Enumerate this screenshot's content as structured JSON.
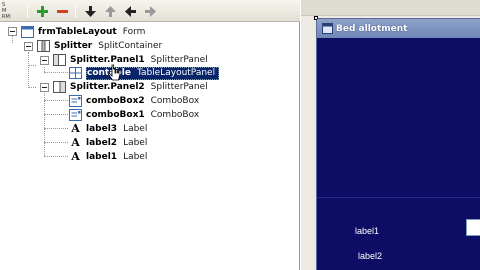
{
  "toolbar": {
    "cut_label_lines": [
      "S",
      "M",
      "RM:"
    ],
    "buttons": [
      "add-icon",
      "delete-icon",
      "move-down-icon",
      "move-up-icon",
      "move-left-icon",
      "move-right-icon"
    ]
  },
  "outline": {
    "nodes": [
      {
        "name": "frmTableLayout",
        "type": "Form",
        "icon": "form-icon"
      },
      {
        "name": "Splitter",
        "type": "SplitContainer",
        "icon": "splitcontainer-icon"
      },
      {
        "name": "Splitter.Panel1",
        "type": "SplitterPanel",
        "icon": "splitterpanel-icon"
      },
      {
        "name": "contTable",
        "type": "TableLayoutPanel",
        "icon": "tablelayoutpanel-icon",
        "selected": true
      },
      {
        "name": "Splitter.Panel2",
        "type": "SplitterPanel",
        "icon": "splitterpanel-icon"
      },
      {
        "name": "comboBox2",
        "type": "ComboBox",
        "icon": "combobox-icon"
      },
      {
        "name": "comboBox1",
        "type": "ComboBox",
        "icon": "combobox-icon"
      },
      {
        "name": "label3",
        "type": "Label",
        "icon": "label-icon"
      },
      {
        "name": "label2",
        "type": "Label",
        "icon": "label-icon"
      },
      {
        "name": "label1",
        "type": "Label",
        "icon": "label-icon"
      }
    ],
    "selected_display_name": "contable"
  },
  "designer": {
    "form_title": "Bed allotment",
    "labels": [
      "label1",
      "label2"
    ],
    "colors": {
      "form_background": "#0d0d66",
      "titlebar": "#7a8fbe",
      "selection": "#0a246a"
    }
  }
}
